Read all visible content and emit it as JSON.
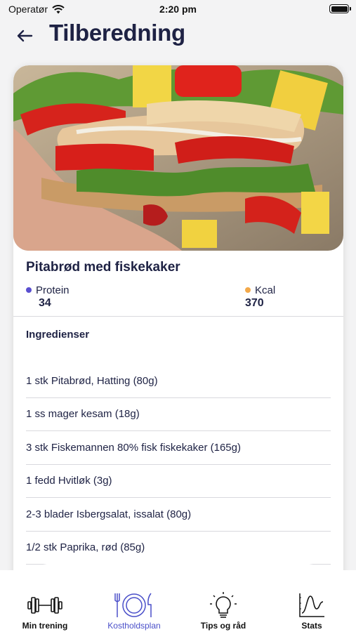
{
  "status_bar": {
    "carrier": "Operatør",
    "time": "2:20 pm"
  },
  "header": {
    "title": "Tilberedning"
  },
  "recipe": {
    "name": "Pitabrød med fiskekaker",
    "macros": [
      {
        "label": "Protein",
        "value": "34",
        "color": "#5a4fd0"
      },
      {
        "label": "Kcal",
        "value": "370",
        "color": "#f3a94a"
      }
    ],
    "ingredients_heading": "Ingredienser",
    "ingredients": [
      "1 stk Pitabrød, Hatting (80g)",
      "1 ss mager kesam (18g)",
      "3 stk Fiskemannen 80% fisk fiskekaker (165g)",
      "1 fedd Hvitløk (3g)",
      "2-3 blader Isbergsalat, issalat (80g)",
      "1/2 stk Paprika, rød (85g)"
    ]
  },
  "tabs": [
    {
      "label": "Min trening",
      "icon": "dumbbell-icon"
    },
    {
      "label": "Kostholdsplan",
      "icon": "plate-cutlery-icon",
      "active": true
    },
    {
      "label": "Tips og råd",
      "icon": "lightbulb-icon"
    },
    {
      "label": "Stats",
      "icon": "chart-icon"
    }
  ],
  "colors": {
    "accent": "#4a4fc9",
    "title": "#1e2244"
  }
}
